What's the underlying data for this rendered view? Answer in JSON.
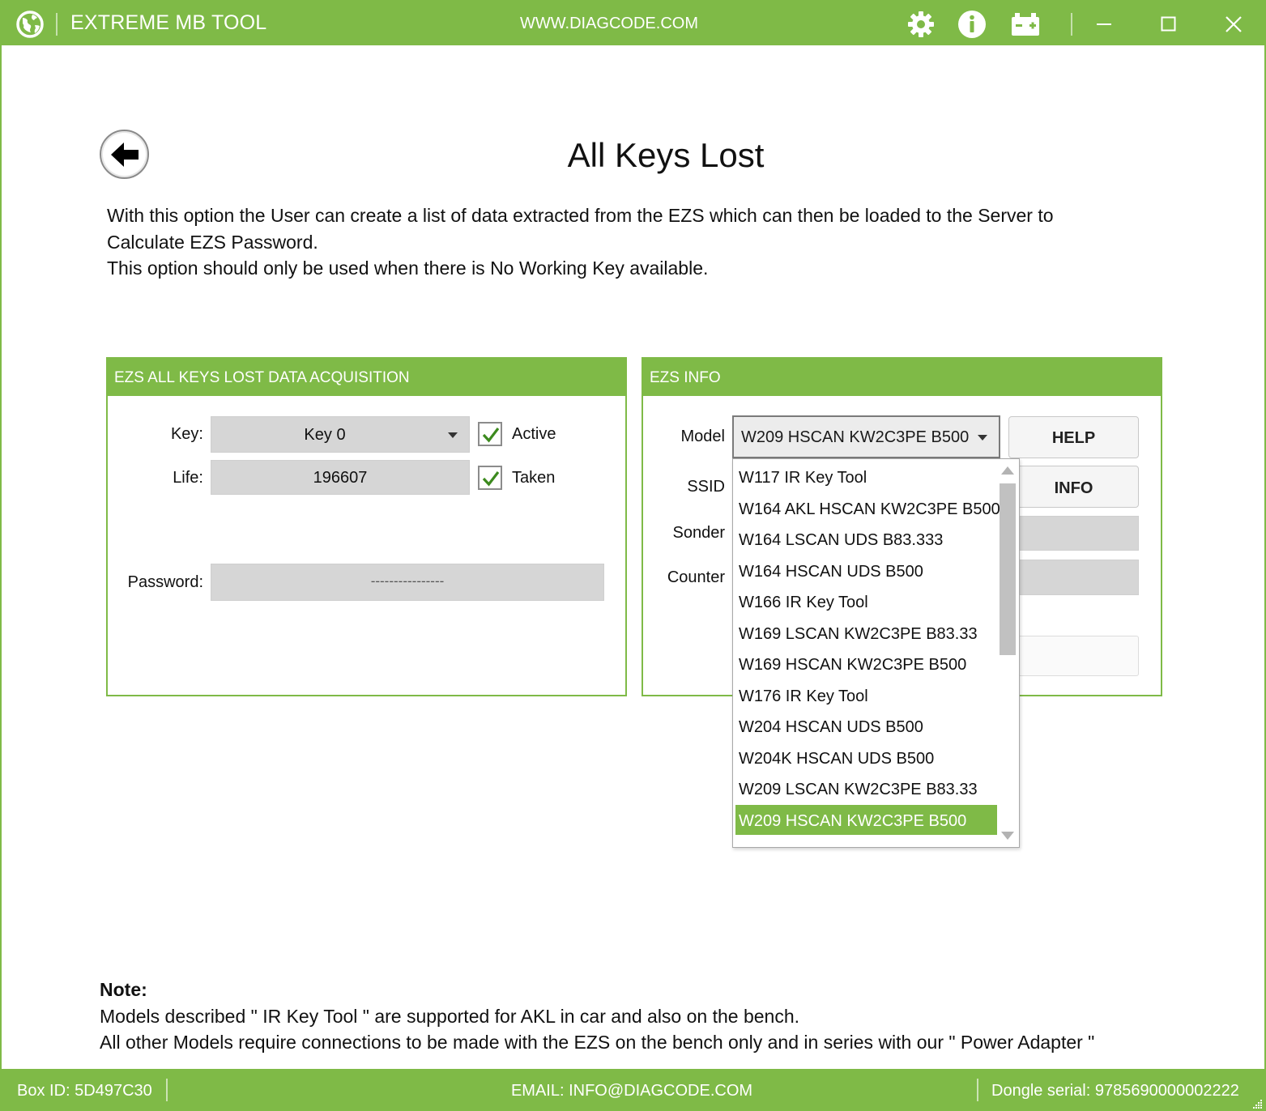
{
  "titlebar": {
    "app_title": "EXTREME MB TOOL",
    "website": "WWW.DIAGCODE.COM",
    "icons": [
      "globe-icon",
      "gear-icon",
      "info-icon",
      "battery-icon",
      "minimize-icon",
      "maximize-icon",
      "close-icon"
    ]
  },
  "page": {
    "title": "All Keys Lost",
    "description": [
      "With this option the User can create a list of data extracted from the EZS which can then be loaded to the Server to",
      "Calculate EZS Password.",
      "This option should only be used when there is No Working Key available."
    ]
  },
  "acquisition": {
    "header": "EZS ALL KEYS LOST DATA ACQUISITION",
    "key_label": "Key:",
    "key_value": "Key 0",
    "active_label": "Active",
    "active_checked": true,
    "life_label": "Life:",
    "life_value": "196607",
    "taken_label": "Taken",
    "taken_checked": true,
    "password_label": "Password:",
    "password_value": "----------------"
  },
  "ezs_info": {
    "header": "EZS INFO",
    "model_label": "Model",
    "model_value": "W209 HSCAN KW2C3PE B500",
    "ssid_label": "SSID",
    "sonder_label": "Sonder",
    "counter_label": "Counter",
    "help_button": "HELP",
    "info_button": "INFO",
    "model_options": [
      "W117 IR Key Tool",
      "W164 AKL HSCAN KW2C3PE B500",
      "W164 LSCAN UDS B83.333",
      "W164 HSCAN UDS B500",
      "W166 IR Key Tool",
      "W169 LSCAN KW2C3PE B83.33",
      "W169 HSCAN KW2C3PE B500",
      "W176 IR Key Tool",
      "W204 HSCAN UDS B500",
      "W204K HSCAN UDS B500",
      "W209 LSCAN KW2C3PE B83.33",
      "W209 HSCAN KW2C3PE B500"
    ],
    "selected_index": 11
  },
  "note": {
    "heading": "Note:",
    "line1": "Models described \" IR Key Tool \" are supported for AKL in car and also on the bench.",
    "line2": "All other Models require connections to be made with the EZS on the bench only and in series with our \" Power Adapter \""
  },
  "statusbar": {
    "box_id": "Box ID: 5D497C30",
    "email": "EMAIL: INFO@DIAGCODE.COM",
    "dongle": "Dongle serial: 9785690000002222"
  },
  "colors": {
    "accent": "#7fba47",
    "field_bg": "#d6d6d6"
  }
}
